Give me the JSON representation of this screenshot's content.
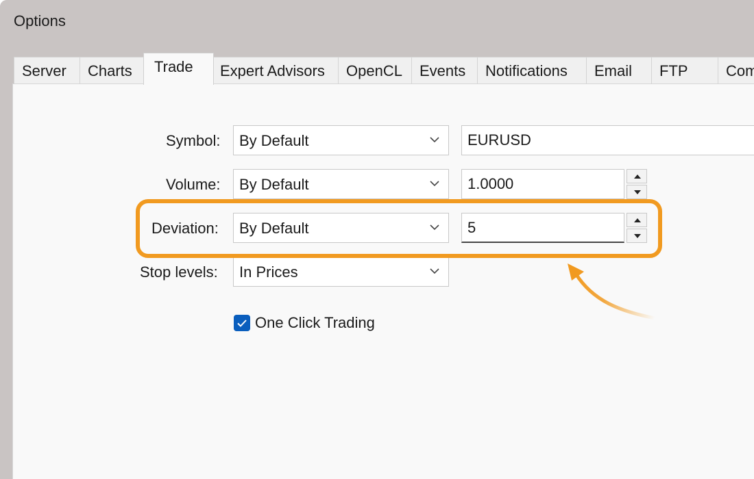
{
  "window": {
    "title": "Options"
  },
  "tabs": [
    {
      "label": "Server"
    },
    {
      "label": "Charts"
    },
    {
      "label": "Trade",
      "active": true
    },
    {
      "label": "Expert Advisors"
    },
    {
      "label": "OpenCL"
    },
    {
      "label": "Events"
    },
    {
      "label": "Notifications"
    },
    {
      "label": "Email"
    },
    {
      "label": "FTP"
    },
    {
      "label": "Com"
    }
  ],
  "trade": {
    "symbol": {
      "label": "Symbol:",
      "mode": "By Default",
      "value": "EURUSD"
    },
    "volume": {
      "label": "Volume:",
      "mode": "By Default",
      "value": "1.0000"
    },
    "deviation": {
      "label": "Deviation:",
      "mode": "By Default",
      "value": "5"
    },
    "stop_levels": {
      "label": "Stop levels:",
      "mode": "In Prices"
    },
    "one_click": {
      "label": "One Click Trading",
      "checked": true
    }
  },
  "colors": {
    "highlight": "#f19a20",
    "checkbox": "#0a5ebd"
  }
}
